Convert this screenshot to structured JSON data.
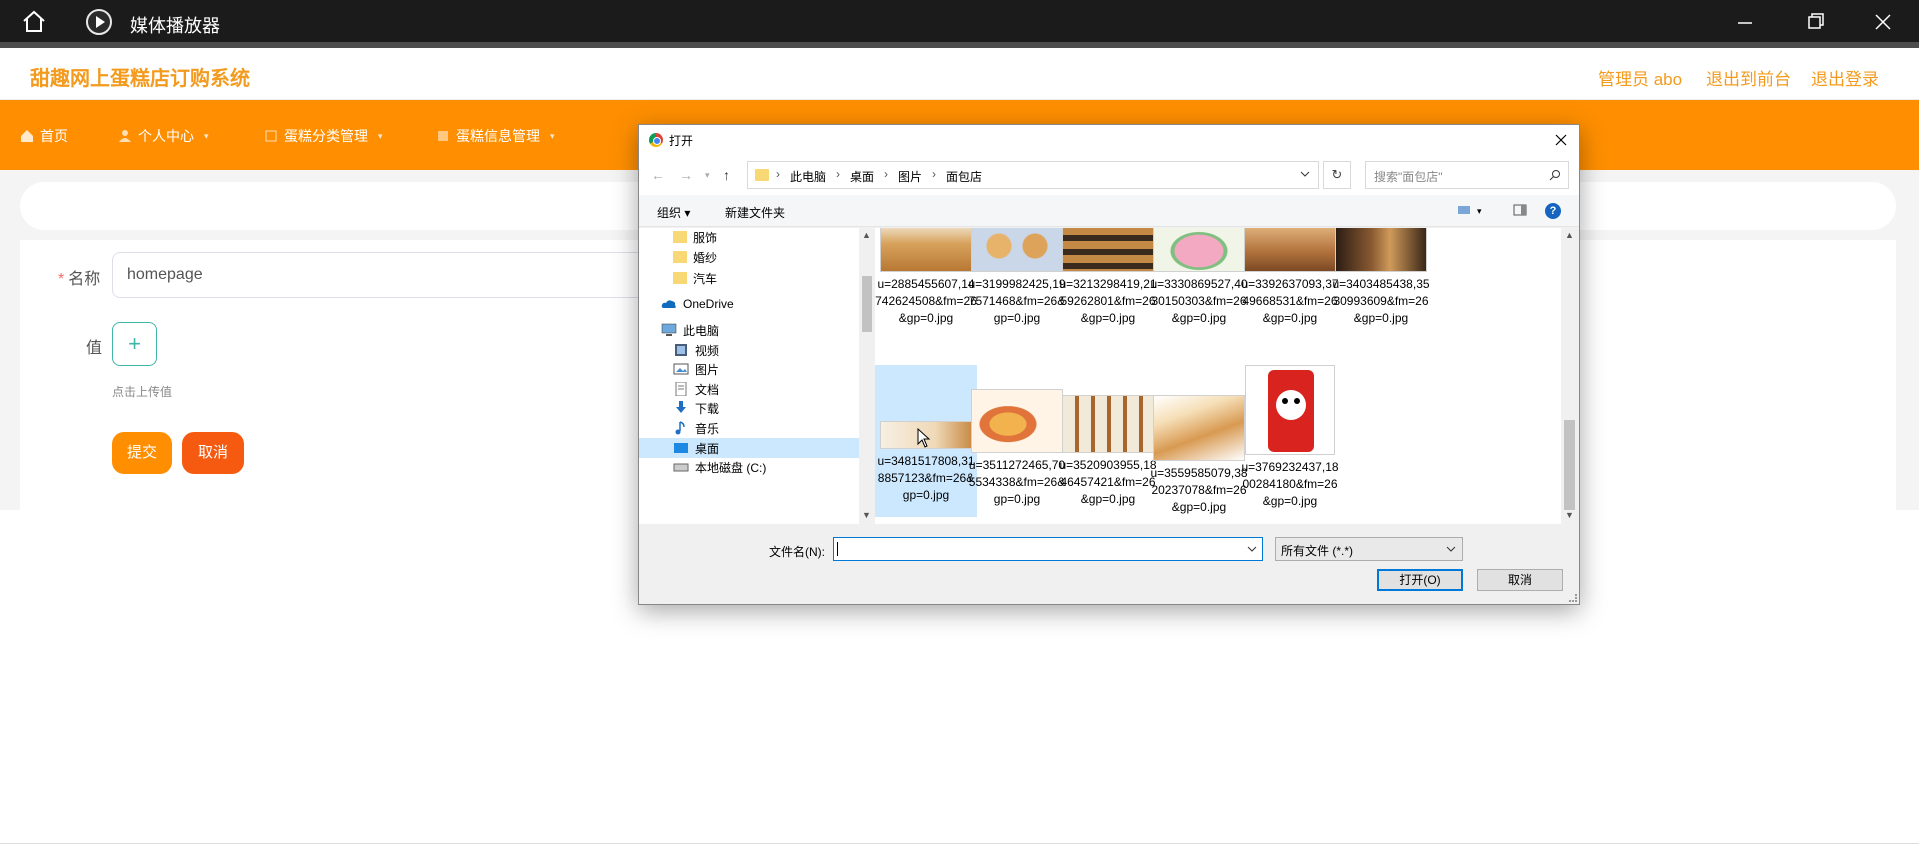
{
  "player": {
    "title": "媒体播放器",
    "icons": [
      "home-icon",
      "play-logo-icon",
      "minimize-icon",
      "restore-icon",
      "close-icon"
    ]
  },
  "header": {
    "site_title": "甜趣网上蛋糕店订购系统",
    "user_label": "管理员 abo",
    "front_link": "退出到前台",
    "logout_link": "退出登录",
    "accent": "#f39b1e"
  },
  "nav": {
    "color": "#ff8f00",
    "items": [
      {
        "label": "首页",
        "icon": "home-icon",
        "has_menu": false
      },
      {
        "label": "个人中心",
        "icon": "user-icon",
        "has_menu": true
      },
      {
        "label": "蛋糕分类管理",
        "icon": "category-icon",
        "has_menu": true
      },
      {
        "label": "蛋糕信息管理",
        "icon": "list-icon",
        "has_menu": true
      }
    ]
  },
  "form": {
    "name_label": "名称",
    "name_value": "homepage",
    "value_label": "值",
    "upload_icon": "+",
    "upload_hint": "点击上传值",
    "submit_label": "提交",
    "cancel_label": "取消"
  },
  "dialog": {
    "title": "打开",
    "path": [
      "此电脑",
      "桌面",
      "图片",
      "面包店"
    ],
    "search_placeholder": "搜索\"面包店\"",
    "organize_label": "组织 ▾",
    "new_folder_label": "新建文件夹",
    "help_label": "?",
    "tree": [
      {
        "label": "服饰",
        "icon": "folder-icon"
      },
      {
        "label": "婚纱",
        "icon": "folder-icon"
      },
      {
        "label": "汽车",
        "icon": "folder-icon"
      },
      {
        "label": "OneDrive",
        "icon": "cloud-icon"
      },
      {
        "label": "此电脑",
        "icon": "computer-icon"
      },
      {
        "label": "视频",
        "icon": "video-icon"
      },
      {
        "label": "图片",
        "icon": "pictures-icon"
      },
      {
        "label": "文档",
        "icon": "documents-icon"
      },
      {
        "label": "下载",
        "icon": "download-icon"
      },
      {
        "label": "音乐",
        "icon": "music-icon"
      },
      {
        "label": "桌面",
        "icon": "desktop-icon",
        "selected": true
      },
      {
        "label": "本地磁盘 (C:)",
        "icon": "drive-icon"
      }
    ],
    "files": [
      {
        "name": "u=2885455607,14742624508&fm=26&gp=0.jpg",
        "thumb": "croissant"
      },
      {
        "name": "u=3199982425,197571468&fm=26&gp=0.jpg",
        "thumb": "buns"
      },
      {
        "name": "u=3213298419,2159262801&fm=26&gp=0.jpg",
        "thumb": "shop-display"
      },
      {
        "name": "u=3330869527,4030150303&fm=26&gp=0.jpg",
        "thumb": "cake"
      },
      {
        "name": "u=3392637093,3749668531&fm=26&gp=0.jpg",
        "thumb": "storefront"
      },
      {
        "name": "u=3403485438,3530993609&fm=26&gp=0.jpg",
        "thumb": "interior"
      },
      {
        "name": "u=3481517808,318857123&fm=26&gp=0.jpg",
        "thumb": "banner",
        "selected": true
      },
      {
        "name": "u=3511272465,705534338&fm=26&gp=0.jpg",
        "thumb": "pastry"
      },
      {
        "name": "u=3520903955,1846457421&fm=26&gp=0.jpg",
        "thumb": "rolls"
      },
      {
        "name": "u=3559585079,3820237078&fm=26&gp=0.jpg",
        "thumb": "toast"
      },
      {
        "name": "u=3769232437,1800284180&fm=26&gp=0.jpg",
        "thumb": "drink-can"
      }
    ],
    "filename_label": "文件名(N):",
    "filename_value": "",
    "filetype_value": "所有文件 (*.*)",
    "open_label": "打开(O)",
    "cancel_label": "取消"
  }
}
